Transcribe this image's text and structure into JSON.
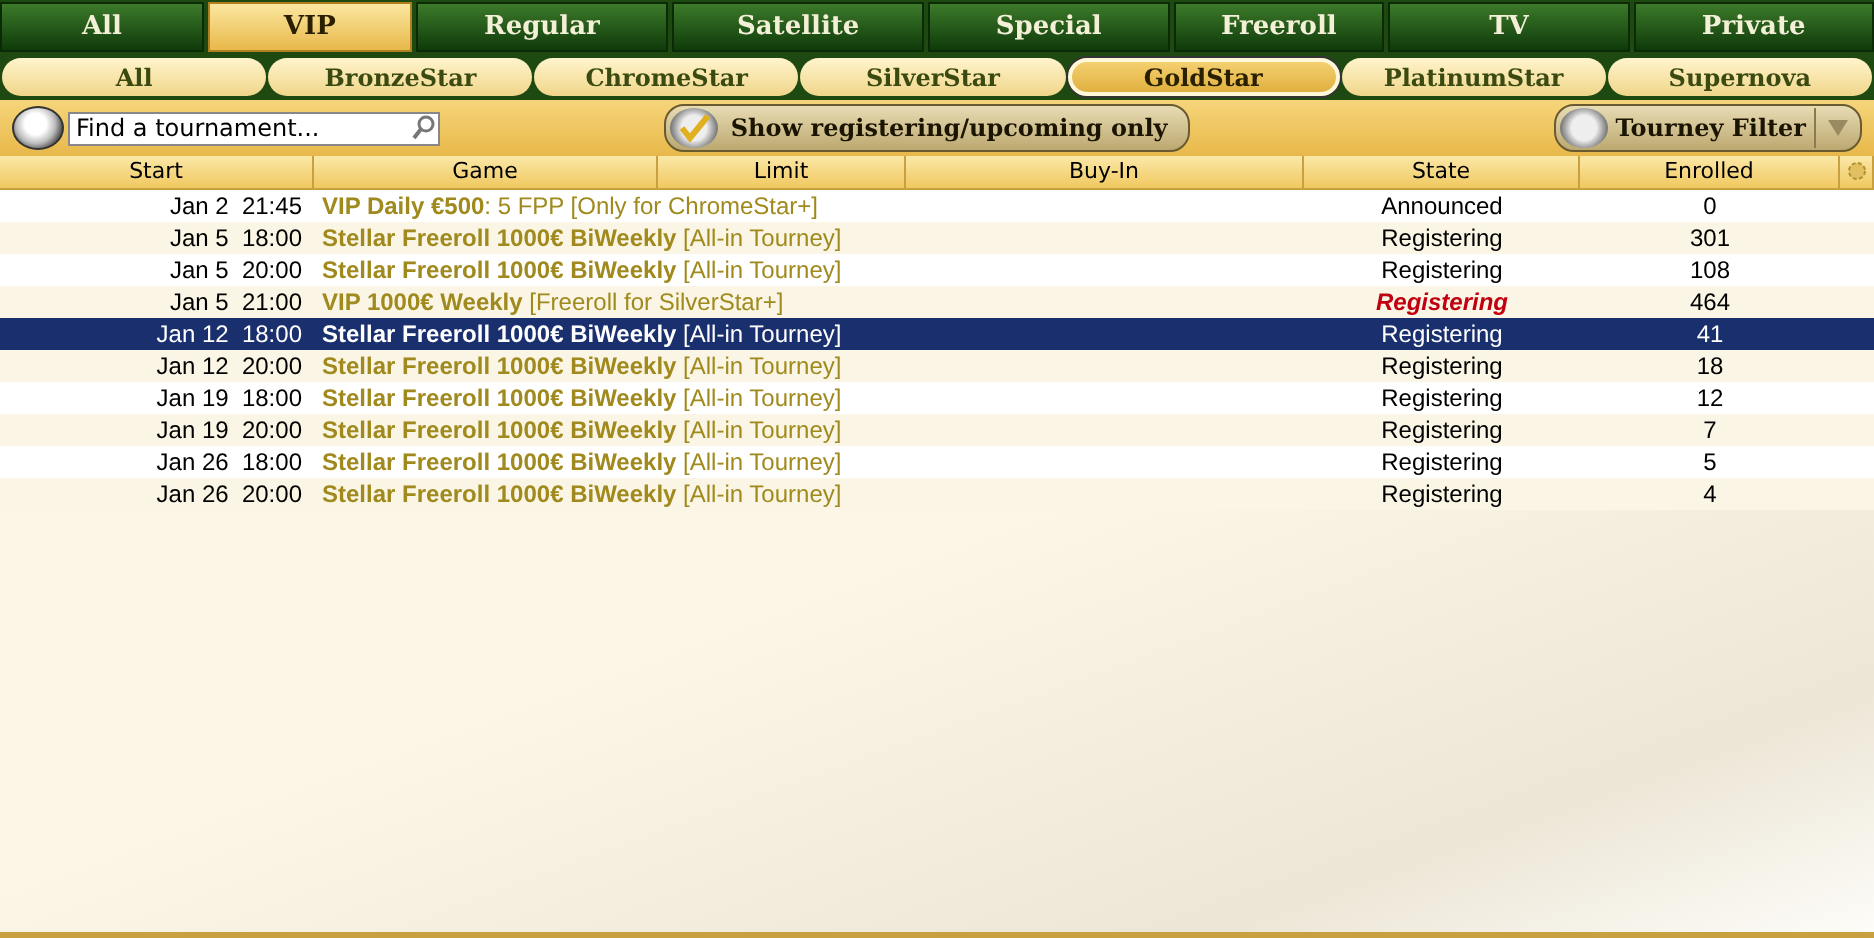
{
  "tabs": [
    {
      "label": "All",
      "selected": false
    },
    {
      "label": "VIP",
      "selected": true
    },
    {
      "label": "Regular",
      "selected": false
    },
    {
      "label": "Satellite",
      "selected": false
    },
    {
      "label": "Special",
      "selected": false
    },
    {
      "label": "Freeroll",
      "selected": false
    },
    {
      "label": "TV",
      "selected": false
    },
    {
      "label": "Private",
      "selected": false
    }
  ],
  "subtabs": [
    {
      "label": "All",
      "selected": false
    },
    {
      "label": "BronzeStar",
      "selected": false
    },
    {
      "label": "ChromeStar",
      "selected": false
    },
    {
      "label": "SilverStar",
      "selected": false
    },
    {
      "label": "GoldStar",
      "selected": true
    },
    {
      "label": "PlatinumStar",
      "selected": false
    },
    {
      "label": "Supernova",
      "selected": false
    }
  ],
  "search": {
    "placeholder": "Find a tournament..."
  },
  "show_registering": {
    "label": "Show registering/upcoming only",
    "checked": true
  },
  "filter_button": {
    "label": "Tourney Filter"
  },
  "table": {
    "columns": [
      "Start",
      "Game",
      "Limit",
      "Buy-In",
      "State",
      "Enrolled"
    ],
    "rows": [
      {
        "start": "Jan 2  21:45",
        "game": "**VIP Daily €500**: 5 FPP [Only for ChromeStar+]",
        "state": "Announced",
        "highlight": false,
        "enrolled": "0",
        "selected": false
      },
      {
        "start": "Jan 5  18:00",
        "game": "**Stellar Freeroll 1000€ BiWeekly** [All-in Tourney]",
        "state": "Registering",
        "highlight": false,
        "enrolled": "301",
        "selected": false
      },
      {
        "start": "Jan 5  20:00",
        "game": "**Stellar Freeroll 1000€ BiWeekly** [All-in Tourney]",
        "state": "Registering",
        "highlight": false,
        "enrolled": "108",
        "selected": false
      },
      {
        "start": "Jan 5  21:00",
        "game": "**VIP 1000€ Weekly** [Freeroll for SilverStar+]",
        "state": "Registering",
        "highlight": true,
        "enrolled": "464",
        "selected": false
      },
      {
        "start": "Jan 12  18:00",
        "game": "**Stellar Freeroll 1000€ BiWeekly** [All-in Tourney]",
        "state": "Registering",
        "highlight": false,
        "enrolled": "41",
        "selected": true
      },
      {
        "start": "Jan 12  20:00",
        "game": "**Stellar Freeroll 1000€ BiWeekly** [All-in Tourney]",
        "state": "Registering",
        "highlight": false,
        "enrolled": "18",
        "selected": false
      },
      {
        "start": "Jan 19  18:00",
        "game": "**Stellar Freeroll 1000€ BiWeekly** [All-in Tourney]",
        "state": "Registering",
        "highlight": false,
        "enrolled": "12",
        "selected": false
      },
      {
        "start": "Jan 19  20:00",
        "game": "**Stellar Freeroll 1000€ BiWeekly** [All-in Tourney]",
        "state": "Registering",
        "highlight": false,
        "enrolled": "7",
        "selected": false
      },
      {
        "start": "Jan 26  18:00",
        "game": "**Stellar Freeroll 1000€ BiWeekly** [All-in Tourney]",
        "state": "Registering",
        "highlight": false,
        "enrolled": "5",
        "selected": false
      },
      {
        "start": "Jan 26  20:00",
        "game": "**Stellar Freeroll 1000€ BiWeekly** [All-in Tourney]",
        "state": "Registering",
        "highlight": false,
        "enrolled": "4",
        "selected": false
      }
    ]
  }
}
